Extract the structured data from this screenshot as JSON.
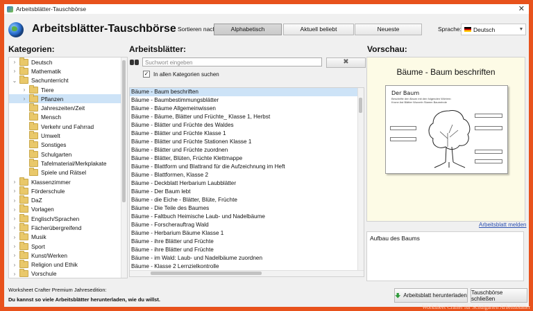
{
  "window": {
    "title": "Arbeitsblätter-Tauschbörse"
  },
  "header": {
    "app_title": "Arbeitsblätter-Tauschbörse",
    "sort_label": "Sortieren nach:",
    "sort_buttons": [
      "Alphabetisch",
      "Aktuell beliebt",
      "Neueste"
    ],
    "language_label": "Sprache:",
    "language_value": "Deutsch"
  },
  "categories": {
    "heading": "Kategorien:",
    "items": [
      {
        "label": "Deutsch",
        "level": 0,
        "expander": ">"
      },
      {
        "label": "Mathematik",
        "level": 0,
        "expander": ">"
      },
      {
        "label": "Sachunterricht",
        "level": 0,
        "expander": "v"
      },
      {
        "label": "Tiere",
        "level": 1,
        "expander": ">"
      },
      {
        "label": "Pflanzen",
        "level": 1,
        "expander": ">"
      },
      {
        "label": "Jahreszeiten/Zeit",
        "level": 1,
        "expander": ""
      },
      {
        "label": "Mensch",
        "level": 1,
        "expander": ""
      },
      {
        "label": "Verkehr und Fahrrad",
        "level": 1,
        "expander": ""
      },
      {
        "label": "Umwelt",
        "level": 1,
        "expander": ""
      },
      {
        "label": "Sonstiges",
        "level": 1,
        "expander": ""
      },
      {
        "label": "Schulgarten",
        "level": 1,
        "expander": ""
      },
      {
        "label": "Tafelmaterial/Merkplakate",
        "level": 1,
        "expander": ""
      },
      {
        "label": "Spiele und Rätsel",
        "level": 1,
        "expander": ""
      },
      {
        "label": "Klassenzimmer",
        "level": 0,
        "expander": ">"
      },
      {
        "label": "Förderschule",
        "level": 0,
        "expander": ">"
      },
      {
        "label": "DaZ",
        "level": 0,
        "expander": ">"
      },
      {
        "label": "Vorlagen",
        "level": 0,
        "expander": ">"
      },
      {
        "label": "Englisch/Sprachen",
        "level": 0,
        "expander": ">"
      },
      {
        "label": "Fächerübergreifend",
        "level": 0,
        "expander": ">"
      },
      {
        "label": "Musik",
        "level": 0,
        "expander": ">"
      },
      {
        "label": "Sport",
        "level": 0,
        "expander": ">"
      },
      {
        "label": "Kunst/Werken",
        "level": 0,
        "expander": ">"
      },
      {
        "label": "Religion und Ethik",
        "level": 0,
        "expander": ">"
      },
      {
        "label": "Vorschule",
        "level": 0,
        "expander": ">"
      }
    ],
    "selected": "Pflanzen"
  },
  "worksheets": {
    "heading": "Arbeitsblätter:",
    "search_placeholder": "Suchwort eingeben",
    "clear_glyph": "✖",
    "checkbox_label": "In allen Kategorien suchen",
    "checkbox_checked": true,
    "items": [
      "Bäume - Baum beschriften",
      "Bäume - Baumbestimmungsblätter",
      "Bäume - Bäume Allgemeinwissen",
      "Bäume - Bäume, Blätter und Früchte_ Klasse 1, Herbst",
      "Bäume - Blätter und Früchte des Waldes",
      "Bäume - Blätter und Früchte Klasse 1",
      "Bäume - Blätter und Früchte Stationen Klasse 1",
      "Bäume - Blätter und Früchte zuordnen",
      "Bäume - Blätter, Blüten, Früchte Klettmappe",
      "Bäume - Blattform und Blattrand für die Aufzeichnung im Heft",
      "Bäume - Blattformen, Klasse 2",
      "Bäume - Deckblatt Herbarium Laubblätter",
      "Bäume - Der Baum lebt",
      "Bäume - die Eiche - Blätter, Blüte, Früchte",
      "Bäume - Die Teile des Baumes",
      "Bäume - Faltbuch Heimische Laub- und Nadelbäume",
      "Bäume - Forscherauftrag Wald",
      "Bäume - Herbarium Bäume Klasse 1",
      "Bäume - ihre Blätter und Früchte",
      "Bäume - ihre Blätter und Früchte",
      "Bäume - im Wald: Laub- und Nadelbäume zuordnen",
      "Bäume - Klasse 2 Lernzielkontrolle"
    ],
    "selected_index": 0
  },
  "preview": {
    "heading": "Vorschau:",
    "title": "Bäume - Baum beschriften",
    "sheet_title": "Der Baum",
    "sheet_subtitle": "Beschrifte den Baum mit den folgenden Wörtern:",
    "sheet_words": "Krone  Ast  Blätter  Wurzeln  Stamm  Baumrinde",
    "report_link": "Arbeitsblatt melden",
    "description": "Aufbau des Baums"
  },
  "footer": {
    "line1": "Worksheet Crafter Premium Jahresedition:",
    "line2": "Du kannst so viele Arbeitsblätter herunterladen, wie du willst.",
    "download_button": "Arbeitsblatt herunterladen",
    "close_button": "Tauschbörse schließen"
  },
  "watermark": "Worksheet Crafter für Schulgarten Arbeitsblätter"
}
